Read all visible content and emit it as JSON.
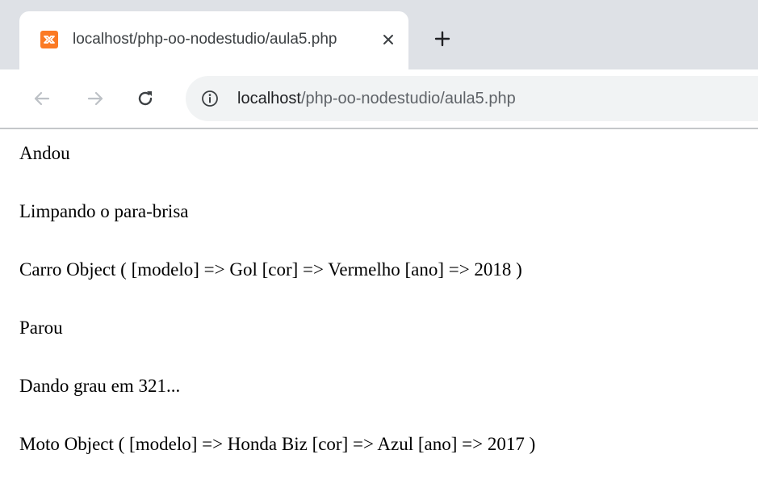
{
  "tab": {
    "title": "localhost/php-oo-nodestudio/aula5.php",
    "favicon": "xampp-icon",
    "favicon_color": "#fb7a24"
  },
  "toolbar": {
    "back_icon": "arrow-left-icon",
    "forward_icon": "arrow-right-icon",
    "reload_icon": "reload-icon",
    "info_icon": "info-icon",
    "url_host": "localhost",
    "url_path": "/php-oo-nodestudio/aula5.php"
  },
  "content": {
    "lines": [
      "Andou",
      "Limpando o para-brisa",
      "Carro Object ( [modelo] => Gol [cor] => Vermelho [ano] => 2018 )",
      "Parou",
      "Dando grau em 321...",
      "Moto Object ( [modelo] => Honda Biz [cor] => Azul [ano] => 2017 )"
    ]
  }
}
